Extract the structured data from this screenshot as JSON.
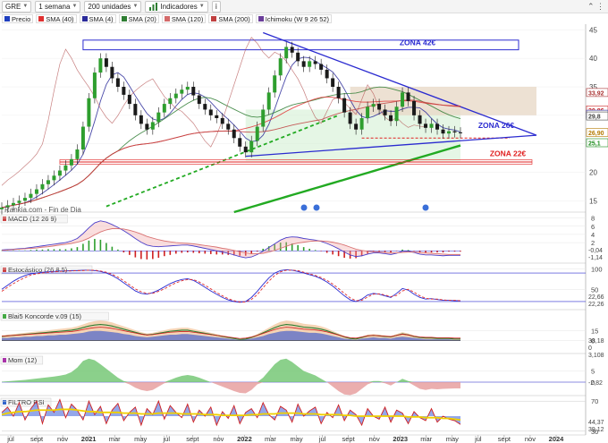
{
  "toolbar": {
    "symbol": "GRE",
    "period": "1 semana",
    "units": "200 unidades",
    "indicators": "Indicadores"
  },
  "legend": [
    {
      "label": "Precio",
      "color": "#1f3fbf"
    },
    {
      "label": "SMA (40)",
      "color": "#e03030"
    },
    {
      "label": "SMA (4)",
      "color": "#2a2a9a"
    },
    {
      "label": "SMA (20)",
      "color": "#2e7d32"
    },
    {
      "label": "SMA (120)",
      "color": "#d46a6a"
    },
    {
      "label": "SMA (200)",
      "color": "#c04040"
    },
    {
      "label": "Ichimoku (W 9 26 52)",
      "color": "#6a3d9a"
    }
  ],
  "chart_data": {
    "type": "candlestick",
    "x_tick_labels": [
      "jul",
      "sept",
      "nov",
      "2021",
      "mar",
      "may",
      "jul",
      "sept",
      "nov",
      "2022",
      "mar",
      "may",
      "jul",
      "sept",
      "nov",
      "2023",
      "mar",
      "may",
      "jul",
      "sept",
      "nov",
      "2024"
    ],
    "main_panel": {
      "ylim": [
        13,
        46
      ],
      "y_ticks": [
        15,
        20,
        25,
        30,
        35,
        40,
        45
      ],
      "watermark": "Rankia.com - Fin de Dia",
      "annotations": [
        {
          "text": "ZONA 42€",
          "level": 42
        },
        {
          "text": "ZONA 26€",
          "level": 26
        },
        {
          "text": "ZONA 22€",
          "level": 22
        }
      ],
      "price_labels": [
        "33,92",
        "30,86",
        "30,11",
        "29,8",
        "26,90",
        "25,1"
      ],
      "close": [
        13.8,
        14.2,
        14.6,
        15.0,
        15.5,
        16.2,
        17.0,
        17.9,
        18.6,
        19.4,
        20.3,
        21.2,
        22.3,
        24.0,
        28.0,
        33.0,
        37.5,
        40.0,
        38.5,
        36.5,
        35.0,
        33.6,
        32.0,
        30.0,
        28.5,
        27.5,
        28.8,
        30.5,
        32.0,
        33.0,
        33.8,
        34.5,
        35.0,
        33.5,
        32.0,
        31.0,
        30.0,
        29.5,
        28.5,
        27.5,
        26.0,
        24.5,
        23.5,
        25.5,
        28.0,
        31.0,
        34.0,
        37.0,
        40.0,
        42.0,
        41.0,
        39.5,
        38.5,
        39.5,
        39.0,
        38.0,
        36.5,
        35.0,
        33.0,
        30.5,
        28.5,
        27.5,
        29.5,
        31.5,
        32.0,
        31.0,
        30.0,
        29.0,
        31.5,
        34.0,
        32.5,
        30.0,
        28.5,
        27.8,
        28.5,
        27.5,
        26.8,
        27.2,
        27.0,
        26.9
      ]
    },
    "indicators": [
      {
        "name": "MACD (12 26 9)",
        "ylim": [
          -3,
          9
        ],
        "y_ticks": [
          2,
          4,
          6,
          8
        ],
        "last_values": [
          "-0,04",
          "-1,14"
        ],
        "macd": [
          0.2,
          0.3,
          0.4,
          0.5,
          0.6,
          0.8,
          1.0,
          1.2,
          1.4,
          1.6,
          1.8,
          2.0,
          2.4,
          3.0,
          4.2,
          5.6,
          6.8,
          7.3,
          7.0,
          6.4,
          5.7,
          4.9,
          4.0,
          3.0,
          2.1,
          1.4,
          1.1,
          1.0,
          1.1,
          1.2,
          1.3,
          1.4,
          1.4,
          1.2,
          0.9,
          0.6,
          0.3,
          0.0,
          -0.3,
          -0.6,
          -1.0,
          -1.4,
          -1.7,
          -1.5,
          -0.9,
          -0.1,
          0.8,
          1.7,
          2.6,
          3.2,
          3.4,
          3.3,
          3.0,
          2.8,
          2.6,
          2.3,
          1.8,
          1.2,
          0.5,
          -0.3,
          -1.0,
          -1.4,
          -1.2,
          -0.8,
          -0.5,
          -0.5,
          -0.7,
          -0.9,
          -0.6,
          -0.1,
          -0.1,
          -0.4,
          -0.8,
          -1.0,
          -1.0,
          -1.1,
          -1.2,
          -1.1,
          -1.1,
          -1.1
        ],
        "signal": [
          0.1,
          0.2,
          0.3,
          0.4,
          0.5,
          0.6,
          0.7,
          0.9,
          1.0,
          1.2,
          1.4,
          1.6,
          1.8,
          2.1,
          2.5,
          3.1,
          3.9,
          4.6,
          5.1,
          5.4,
          5.4,
          5.3,
          5.0,
          4.6,
          4.1,
          3.5,
          3.1,
          2.7,
          2.4,
          2.2,
          2.0,
          1.9,
          1.8,
          1.7,
          1.5,
          1.3,
          1.1,
          0.9,
          0.6,
          0.4,
          0.1,
          -0.2,
          -0.5,
          -0.7,
          -0.7,
          -0.6,
          -0.3,
          0.1,
          0.6,
          1.1,
          1.6,
          1.9,
          2.1,
          2.3,
          2.4,
          2.4,
          2.3,
          2.1,
          1.8,
          1.4,
          0.9,
          0.4,
          0.1,
          -0.1,
          -0.2,
          -0.3,
          -0.4,
          -0.5,
          -0.5,
          -0.4,
          -0.3,
          -0.3,
          -0.4,
          -0.5,
          -0.6,
          -0.7,
          -0.8,
          -0.9,
          -0.9,
          -0.9
        ]
      },
      {
        "name": "Estocástico (26 8 5)",
        "ylim": [
          0,
          110
        ],
        "y_ticks": [
          100,
          50
        ],
        "last_values": [
          "22,66",
          "22,26"
        ],
        "k": [
          50,
          60,
          70,
          78,
          84,
          88,
          90,
          92,
          93,
          94,
          95,
          95,
          96,
          96,
          97,
          97,
          96,
          94,
          90,
          84,
          76,
          66,
          56,
          46,
          40,
          38,
          42,
          48,
          56,
          64,
          70,
          74,
          76,
          72,
          64,
          55,
          46,
          38,
          30,
          24,
          20,
          18,
          20,
          30,
          45,
          62,
          78,
          90,
          96,
          98,
          97,
          94,
          90,
          86,
          82,
          76,
          68,
          58,
          46,
          34,
          24,
          20,
          26,
          36,
          40,
          38,
          34,
          30,
          40,
          52,
          48,
          38,
          30,
          26,
          27,
          25,
          23,
          23,
          22,
          22
        ],
        "d": [
          45,
          55,
          64,
          72,
          79,
          85,
          88,
          90,
          92,
          93,
          94,
          95,
          95,
          96,
          96,
          97,
          97,
          95,
          92,
          87,
          80,
          71,
          61,
          51,
          44,
          40,
          40,
          45,
          51,
          59,
          66,
          71,
          74,
          74,
          68,
          60,
          51,
          42,
          34,
          27,
          22,
          19,
          19,
          25,
          37,
          54,
          70,
          84,
          93,
          97,
          97,
          96,
          92,
          88,
          84,
          79,
          72,
          63,
          52,
          40,
          29,
          22,
          23,
          31,
          38,
          39,
          36,
          32,
          35,
          46,
          50,
          43,
          34,
          28,
          26,
          26,
          24,
          23,
          23,
          22
        ]
      },
      {
        "name": "Blai5 Koncorde v.09 (15)",
        "ylim": [
          -20,
          45
        ],
        "y_ticks": [
          0,
          15
        ],
        "last_values": [
          "38,18",
          "0",
          "3,108"
        ],
        "green": [
          8,
          9,
          10,
          11,
          12,
          13,
          14,
          15,
          16,
          17,
          18,
          19,
          20,
          22,
          25,
          28,
          30,
          31,
          30,
          28,
          25,
          22,
          19,
          16,
          13,
          11,
          12,
          14,
          16,
          18,
          19,
          20,
          20,
          18,
          16,
          14,
          12,
          10,
          8,
          6,
          4,
          2,
          3,
          6,
          10,
          15,
          20,
          25,
          29,
          31,
          30,
          28,
          26,
          25,
          24,
          22,
          19,
          15,
          11,
          7,
          4,
          3,
          6,
          9,
          10,
          9,
          8,
          7,
          10,
          13,
          11,
          8,
          6,
          5,
          5,
          4,
          4,
          4,
          3,
          3
        ],
        "blue": [
          4,
          4,
          5,
          5,
          6,
          6,
          7,
          7,
          8,
          8,
          9,
          9,
          10,
          11,
          12,
          14,
          15,
          15,
          14,
          13,
          12,
          10,
          9,
          7,
          6,
          5,
          6,
          7,
          8,
          9,
          9,
          10,
          10,
          9,
          8,
          7,
          6,
          5,
          4,
          3,
          2,
          1,
          2,
          3,
          5,
          7,
          10,
          12,
          14,
          15,
          15,
          14,
          13,
          12,
          12,
          11,
          9,
          7,
          5,
          3,
          2,
          1,
          3,
          4,
          5,
          4,
          4,
          3,
          5,
          6,
          5,
          4,
          3,
          2,
          2,
          2,
          2,
          2,
          1,
          1
        ]
      },
      {
        "name": "Mom (12)",
        "ylim": [
          -6,
          12
        ],
        "y_ticks": [
          5,
          0
        ],
        "last_values": [
          "-2,82"
        ],
        "values": [
          0.2,
          0.4,
          0.6,
          0.8,
          1.0,
          1.3,
          1.6,
          1.9,
          2.2,
          2.5,
          2.9,
          3.4,
          4.5,
          6.5,
          9.5,
          10.5,
          9.8,
          8.0,
          6.0,
          4.0,
          2.0,
          0.5,
          -1.0,
          -2.5,
          -3.5,
          -4.0,
          -3.5,
          -2.0,
          -0.5,
          1.0,
          2.0,
          2.8,
          3.2,
          2.8,
          2.0,
          1.0,
          0.0,
          -1.0,
          -2.0,
          -3.0,
          -4.0,
          -4.8,
          -5.0,
          -3.5,
          -1.0,
          2.0,
          5.0,
          8.0,
          10.0,
          10.5,
          9.0,
          7.0,
          5.0,
          4.0,
          3.0,
          1.5,
          0.0,
          -2.0,
          -4.0,
          -5.5,
          -5.8,
          -5.0,
          -3.0,
          -1.0,
          0.5,
          0.5,
          -0.5,
          -1.5,
          0.0,
          1.5,
          0.5,
          -1.5,
          -3.0,
          -3.5,
          -3.0,
          -3.2,
          -3.0,
          -2.9,
          -2.8,
          -2.8
        ]
      },
      {
        "name": "FILTRO RSI",
        "ylim": [
          25,
          75
        ],
        "y_ticks": [
          70,
          30
        ],
        "last_values": [
          "44,37",
          "39,12"
        ],
        "rsi": [
          55,
          62,
          50,
          68,
          45,
          60,
          70,
          40,
          65,
          55,
          72,
          48,
          66,
          58,
          45,
          70,
          52,
          63,
          40,
          58,
          67,
          44,
          55,
          62,
          38,
          60,
          52,
          70,
          46,
          64,
          55,
          48,
          66,
          42,
          58,
          50,
          62,
          38,
          56,
          47,
          64,
          40,
          55,
          60,
          48,
          68,
          52,
          45,
          63,
          58,
          42,
          66,
          50,
          57,
          62,
          40,
          55,
          48,
          65,
          44,
          58,
          52,
          38,
          60,
          50,
          46,
          62,
          42,
          58,
          54,
          40,
          56,
          48,
          44,
          60,
          42,
          50,
          46,
          44,
          39
        ],
        "filter": [
          52,
          54,
          55,
          56,
          56,
          57,
          58,
          58,
          58,
          58,
          59,
          59,
          59,
          58,
          57,
          56,
          56,
          55,
          55,
          55,
          55,
          54,
          54,
          54,
          53,
          53,
          53,
          54,
          54,
          54,
          54,
          53,
          53,
          53,
          53,
          52,
          52,
          52,
          51,
          51,
          51,
          51,
          51,
          52,
          52,
          53,
          53,
          53,
          54,
          54,
          54,
          54,
          53,
          53,
          53,
          52,
          52,
          52,
          52,
          51,
          51,
          50,
          50,
          50,
          50,
          50,
          50,
          50,
          50,
          50,
          49,
          49,
          49,
          48,
          48,
          48,
          47,
          47,
          46,
          45
        ]
      }
    ]
  }
}
